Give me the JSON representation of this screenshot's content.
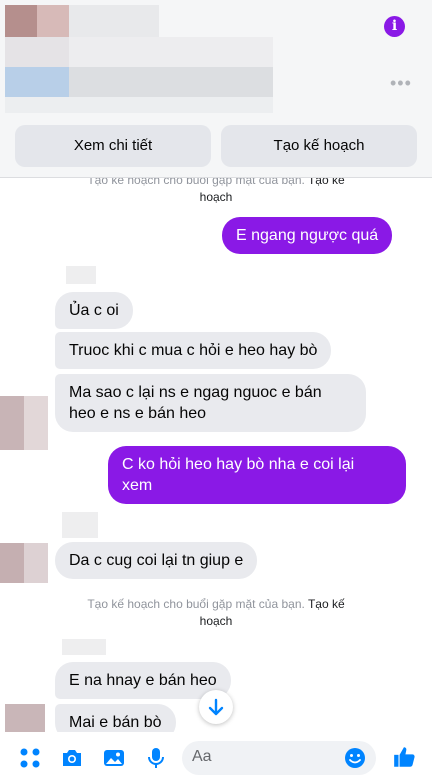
{
  "header": {
    "info_icon": "info-icon",
    "info_glyph": "i",
    "more_icon": "more-dots-icon",
    "more_glyph": "•••",
    "actions": [
      {
        "label": "Xem chi tiết"
      },
      {
        "label": "Tạo kế hoạch"
      }
    ]
  },
  "chat": {
    "system_top": {
      "text": "Tạo kế hoạch cho buổi gặp mặt của bạn.",
      "link": "Tạo kế",
      "link2": "hoạch"
    },
    "messages": [
      {
        "text": "E ngang ngược quá",
        "from": "me"
      },
      {
        "text": "Ủa c oi",
        "from": "other"
      },
      {
        "text": "Truoc khi c mua c hỏi e heo hay bò",
        "from": "other"
      },
      {
        "text": "Ma sao c lại ns e ngag nguoc e bán",
        "text2": "heo e ns e bán heo",
        "from": "other"
      },
      {
        "text": "C ko hỏi heo hay bò nha e coi lại",
        "text2": "xem",
        "from": "me"
      },
      {
        "text": "Da c cug coi lại tn giup e",
        "from": "other"
      },
      {
        "text": "E na hnay e bán heo",
        "from": "other"
      },
      {
        "text": "Mai e bán bò",
        "from": "other"
      }
    ],
    "system_mid": {
      "text": "Tạo kế hoạch cho buổi gặp mặt của bạn.",
      "link": "Tạo kế",
      "link2": "hoạch"
    },
    "scroll_icon": "arrow-down-icon"
  },
  "composer": {
    "placeholder": "Aa",
    "icons": [
      "apps-icon",
      "camera-icon",
      "image-icon",
      "microphone-icon",
      "emoji-icon",
      "like-icon"
    ]
  },
  "colors": {
    "accent": "#8a19e6",
    "messenger_blue": "#0084ff",
    "bubble_grey": "#e9eaee"
  }
}
